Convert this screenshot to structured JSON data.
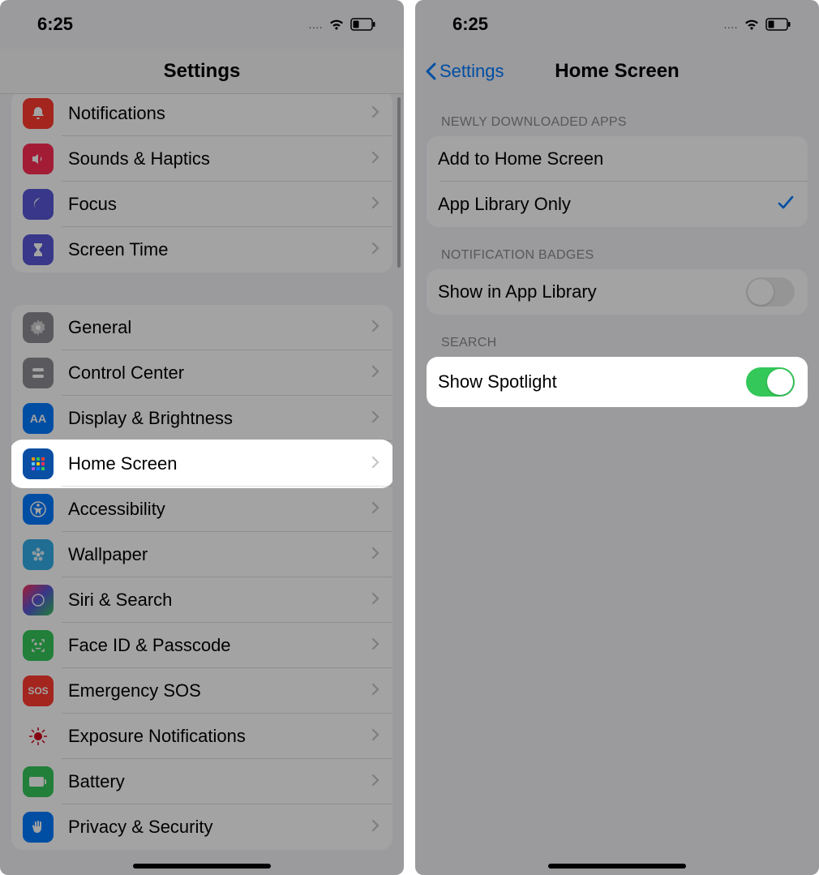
{
  "status": {
    "time": "6:25",
    "dots": "...."
  },
  "left": {
    "title": "Settings",
    "group1": [
      {
        "label": "Notifications",
        "icon": "bell-icon",
        "color": "ic-red"
      },
      {
        "label": "Sounds & Haptics",
        "icon": "speaker-icon",
        "color": "ic-pink"
      },
      {
        "label": "Focus",
        "icon": "moon-icon",
        "color": "ic-indigo"
      },
      {
        "label": "Screen Time",
        "icon": "hourglass-icon",
        "color": "ic-indigo"
      }
    ],
    "group2": [
      {
        "label": "General",
        "icon": "gear-icon",
        "color": "ic-grey"
      },
      {
        "label": "Control Center",
        "icon": "switches-icon",
        "color": "ic-grey"
      },
      {
        "label": "Display & Brightness",
        "icon": "text-size-icon",
        "color": "ic-blue"
      },
      {
        "label": "Home Screen",
        "icon": "apps-grid-icon",
        "color": "ic-deepblue",
        "highlight": true
      },
      {
        "label": "Accessibility",
        "icon": "accessibility-icon",
        "color": "ic-blue"
      },
      {
        "label": "Wallpaper",
        "icon": "flower-icon",
        "color": "ic-cyan"
      },
      {
        "label": "Siri & Search",
        "icon": "siri-icon",
        "color": "ic-gradient"
      },
      {
        "label": "Face ID & Passcode",
        "icon": "faceid-icon",
        "color": "ic-green"
      },
      {
        "label": "Emergency SOS",
        "icon": "sos-icon",
        "color": "ic-red",
        "textIcon": "SOS"
      },
      {
        "label": "Exposure Notifications",
        "icon": "exposure-icon",
        "color": "ic-darkred"
      },
      {
        "label": "Battery",
        "icon": "battery-icon",
        "color": "ic-green"
      },
      {
        "label": "Privacy & Security",
        "icon": "hand-icon",
        "color": "ic-hand"
      }
    ]
  },
  "right": {
    "back": "Settings",
    "title": "Home Screen",
    "section1Header": "NEWLY DOWNLOADED APPS",
    "section1": [
      {
        "label": "Add to Home Screen",
        "checked": false
      },
      {
        "label": "App Library Only",
        "checked": true
      }
    ],
    "section2Header": "NOTIFICATION BADGES",
    "section2": {
      "label": "Show in App Library",
      "on": false
    },
    "section3Header": "SEARCH",
    "section3": {
      "label": "Show Spotlight",
      "on": true
    }
  }
}
